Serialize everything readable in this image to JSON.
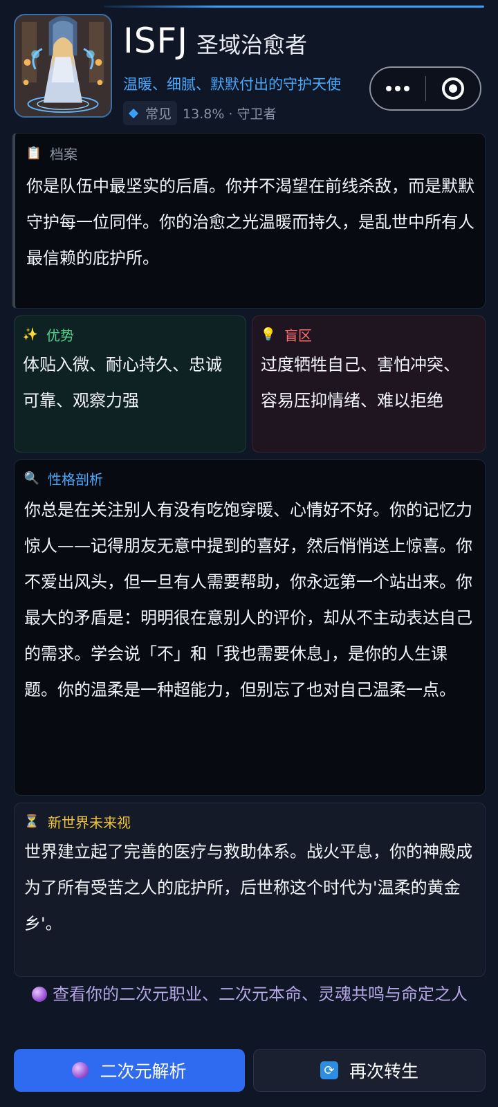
{
  "header": {
    "mbti": "ISFJ",
    "role": "圣域治愈者",
    "tagline": "温暖、细腻、默默付出的守护天使",
    "rarity_label": "常见",
    "stat": "13.8% · 守卫者"
  },
  "archive": {
    "icon": "clipboard-icon",
    "title": "档案",
    "text": "你是队伍中最坚实的后盾。你并不渴望在前线杀敌，而是默默守护每一位同伴。你的治愈之光温暖而持久，是乱世中所有人最信赖的庇护所。"
  },
  "strengths": {
    "icon": "sparkles-icon",
    "title": "优势",
    "text": "体贴入微、耐心持久、忠诚可靠、观察力强"
  },
  "blindspots": {
    "icon": "lightbulb-icon",
    "title": "盲区",
    "text": "过度牺牲自己、害怕冲突、容易压抑情绪、难以拒绝"
  },
  "analysis": {
    "icon": "magnifier-icon",
    "title": "性格剖析",
    "text": "你总是在关注别人有没有吃饱穿暖、心情好不好。你的记忆力惊人——记得朋友无意中提到的喜好，然后悄悄送上惊喜。你不爱出风头，但一旦有人需要帮助，你永远第一个站出来。你最大的矛盾是：明明很在意别人的评价，却从不主动表达自己的需求。学会说「不」和「我也需要休息」，是你的人生课题。你的温柔是一种超能力，但别忘了也对自己温柔一点。"
  },
  "future": {
    "icon": "hourglass-icon",
    "title": "新世界未来视",
    "text": "世界建立起了完善的医疗与救助体系。战火平息，你的神殿成为了所有受苦之人的庇护所，后世称这个时代为'温柔的黄金乡'。"
  },
  "link": {
    "text": "查看你的二次元职业、二次元本命、灵魂共鸣与命定之人"
  },
  "buttons": {
    "primary": "二次元解析",
    "secondary": "再次转生"
  },
  "colors": {
    "accent_blue": "#3aa0ff",
    "strength_green": "#4fd08a",
    "blind_red": "#ff6a6a",
    "future_gold": "#f0c43a",
    "primary_button": "#2f6bf0"
  }
}
